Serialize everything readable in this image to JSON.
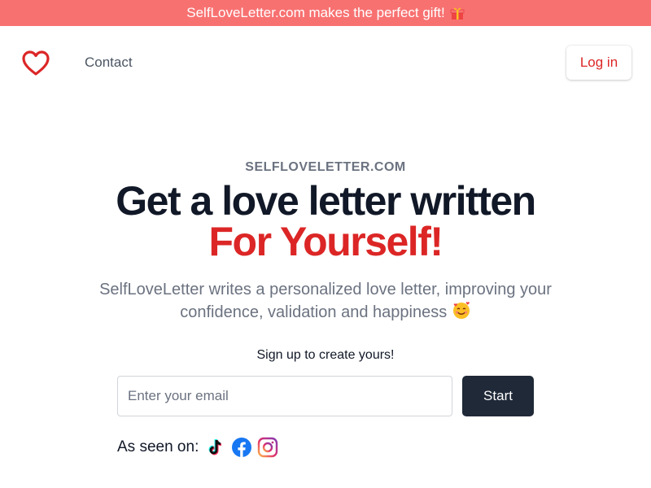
{
  "banner": {
    "text": "SelfLoveLetter.com makes the perfect gift!",
    "icon": "gift-icon"
  },
  "nav": {
    "logo_icon": "heart-icon",
    "contact": "Contact",
    "login": "Log in"
  },
  "hero": {
    "eyebrow": "SELFLOVELETTER.COM",
    "headline_line1": "Get a love letter written",
    "headline_line2": "For Yourself!",
    "subtitle": "SelfLoveLetter writes a personalized love letter, improving your confidence, validation and happiness",
    "subtitle_emoji": "smiling-face-with-hearts-icon"
  },
  "signup": {
    "label": "Sign up to create yours!",
    "email_value": "",
    "email_placeholder": "Enter your email",
    "start": "Start"
  },
  "seen_on": {
    "label": "As seen on:",
    "platforms": [
      "tiktok-icon",
      "facebook-icon",
      "instagram-icon"
    ]
  },
  "colors": {
    "banner": "#f87171",
    "accent_red": "#dc2626",
    "dark": "#1f2937",
    "heading": "#111827",
    "muted": "#6b7280"
  }
}
